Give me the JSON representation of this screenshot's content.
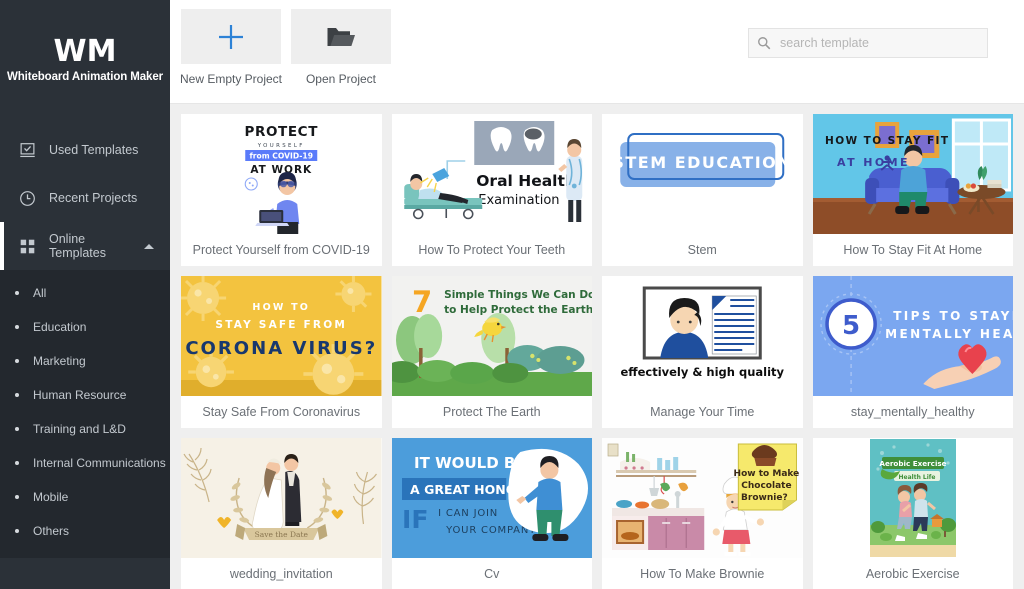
{
  "brand": {
    "logo": "WM",
    "name": "Whiteboard Animation Maker"
  },
  "colors": {
    "sidebar_bg": "#2b3138",
    "submenu_bg": "#23282e",
    "page_bg": "#efefef",
    "accent_blue": "#1e88e5",
    "active_bar": "#ffffff",
    "text_muted": "#6b7076"
  },
  "sidebar": {
    "items": [
      {
        "label": "Used Templates",
        "icon": "checked-document-icon",
        "active": false
      },
      {
        "label": "Recent Projects",
        "icon": "clock-icon",
        "active": false
      },
      {
        "label": "Online Templates",
        "icon": "grid-squares-icon",
        "active": true,
        "caret": "chevron-up-icon"
      }
    ],
    "submenu": [
      {
        "label": "All",
        "selected": true
      },
      {
        "label": "Education",
        "selected": false
      },
      {
        "label": "Marketing",
        "selected": false
      },
      {
        "label": "Human Resource",
        "selected": false
      },
      {
        "label": "Training and L&D",
        "selected": false
      },
      {
        "label": "Internal Communications",
        "selected": false
      },
      {
        "label": "Mobile",
        "selected": false
      },
      {
        "label": "Others",
        "selected": false
      }
    ]
  },
  "toolbar": {
    "new_project_label": "New Empty Project",
    "new_project_icon": "plus-icon",
    "open_project_label": "Open Project",
    "open_project_icon": "folder-icon"
  },
  "search": {
    "placeholder": "search template",
    "value": "",
    "icon": "search-icon"
  },
  "templates": [
    {
      "id": "covid-work",
      "title": "Protect Yourself from COVID-19",
      "art": "covid",
      "text": {
        "l1": "PROTECT",
        "l2": "Y O U R S E L F",
        "l3": "from COVID-19",
        "l4": "AT WORK"
      }
    },
    {
      "id": "oral-health",
      "title": "How To Protect Your Teeth",
      "art": "teeth",
      "text": {
        "l1": "Oral Health",
        "l2": "Examination"
      }
    },
    {
      "id": "stem",
      "title": "Stem",
      "art": "stem",
      "text": {
        "l1": "STEM EDUCATION"
      }
    },
    {
      "id": "stay-fit",
      "title": "How To Stay Fit At Home",
      "art": "fit",
      "text": {
        "l1": "HOW TO STAY FIT",
        "l2": "AT HOME"
      }
    },
    {
      "id": "corona",
      "title": "Stay Safe From Coronavirus",
      "art": "corona",
      "text": {
        "l1": "HOW TO",
        "l2": "STAY SAFE FROM",
        "l3": "CORONA VIRUS?"
      }
    },
    {
      "id": "earth",
      "title": "Protect The Earth",
      "art": "earth",
      "text": {
        "num": "7",
        "l1": "Simple Things We Can Do",
        "l2": "to Help Protect the Earth"
      }
    },
    {
      "id": "manage-time",
      "title": "Manage Your Time",
      "art": "time",
      "text": {
        "l1": "effectively & high quality"
      }
    },
    {
      "id": "mentally-healthy",
      "title": "stay_mentally_healthy",
      "art": "mental",
      "text": {
        "num": "5",
        "l1": "TIPS TO STAYING",
        "l2": "MENTALLY HEALTHY"
      }
    },
    {
      "id": "wedding",
      "title": "wedding_invitation",
      "art": "wedding",
      "text": {
        "l1": "Save the Date"
      }
    },
    {
      "id": "cv",
      "title": "Cv",
      "art": "cv",
      "text": {
        "l1": "IT WOULD BE",
        "l2": "A GREAT HONOR",
        "l3": "IF",
        "l4": "I CAN JOIN",
        "l5": "YOUR COMPANY"
      }
    },
    {
      "id": "brownie",
      "title": "How To Make Brownie",
      "art": "brownie",
      "text": {
        "l1": "How to Make",
        "l2": "Chocolate",
        "l3": "Brownie?"
      }
    },
    {
      "id": "aerobic",
      "title": "Aerobic Exercise",
      "art": "aerobic",
      "text": {
        "l1": "Aerobic Exercise",
        "l2": "Health Life"
      }
    }
  ]
}
